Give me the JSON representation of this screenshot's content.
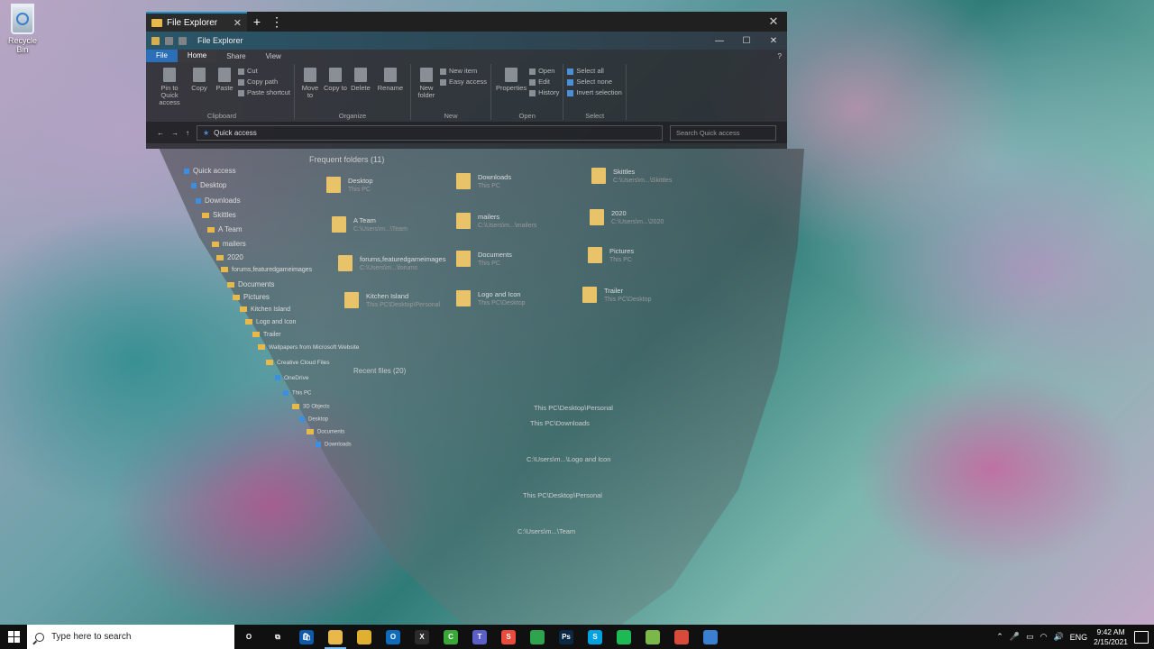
{
  "desktop": {
    "recycle_bin": "Recycle Bin"
  },
  "browser": {
    "tab_title": "File Explorer",
    "new_tab": "+",
    "menu": "⋮",
    "close": "✕"
  },
  "explorer": {
    "title": "File Explorer",
    "window_controls": {
      "min": "—",
      "max": "☐",
      "close": "✕"
    },
    "ribbon_tabs": [
      "File",
      "Home",
      "Share",
      "View"
    ],
    "help": "?",
    "clipboard": {
      "pin": "Pin to Quick access",
      "copy": "Copy",
      "paste": "Paste",
      "cut": "Cut",
      "copy_path": "Copy path",
      "paste_shortcut": "Paste shortcut",
      "caption": "Clipboard"
    },
    "organize": {
      "move_to": "Move to",
      "copy_to": "Copy to",
      "delete": "Delete",
      "rename": "Rename",
      "caption": "Organize"
    },
    "new": {
      "new_folder": "New folder",
      "new_item": "New item",
      "easy_access": "Easy access",
      "caption": "New"
    },
    "open": {
      "properties": "Properties",
      "open": "Open",
      "edit": "Edit",
      "history": "History",
      "caption": "Open"
    },
    "select": {
      "select_all": "Select all",
      "select_none": "Select none",
      "invert": "Invert selection",
      "caption": "Select"
    },
    "address": {
      "path": "Quick access",
      "search_placeholder": "Search Quick access"
    },
    "nav": [
      "Quick access",
      "Desktop",
      "Downloads",
      "Skittles",
      "A Team",
      "mailers",
      "2020",
      "forums,featuredgameimages",
      "Documents",
      "Pictures",
      "Kitchen Island",
      "Logo and Icon",
      "Trailer",
      "Wallpapers from Microsoft Website",
      "Creative Cloud Files",
      "OneDrive",
      "This PC",
      "3D Objects",
      "Desktop",
      "Documents",
      "Downloads"
    ],
    "frequent_header": "Frequent folders (11)",
    "frequent": [
      {
        "name": "Desktop",
        "loc": "This PC"
      },
      {
        "name": "Downloads",
        "loc": "This PC"
      },
      {
        "name": "Skittles",
        "loc": "C:\\Users\\m...\\Skittles"
      },
      {
        "name": "A Team",
        "loc": "C:\\Users\\m...\\Team"
      },
      {
        "name": "mailers",
        "loc": "C:\\Users\\m...\\mailers"
      },
      {
        "name": "2020",
        "loc": "C:\\Users\\m...\\2020"
      },
      {
        "name": "forums,featuredgameimages",
        "loc": "C:\\Users\\m...\\forums"
      },
      {
        "name": "Documents",
        "loc": "This PC"
      },
      {
        "name": "Pictures",
        "loc": "This PC"
      },
      {
        "name": "Kitchen Island",
        "loc": "This PC\\Desktop\\Personal"
      },
      {
        "name": "Logo and Icon",
        "loc": "This PC\\Desktop"
      },
      {
        "name": "Trailer",
        "loc": "This PC\\Desktop"
      }
    ],
    "recent_header": "Recent files (20)",
    "recent_paths": [
      "This PC\\Desktop\\Personal",
      "This PC\\Downloads",
      "C:\\Users\\m...\\Logo and Icon",
      "This PC\\Desktop\\Personal",
      "C:\\Users\\m...\\Team"
    ]
  },
  "taskbar": {
    "search_placeholder": "Type here to search",
    "apps": [
      {
        "name": "task-view",
        "label": "O",
        "color": "#101010"
      },
      {
        "name": "multitask",
        "label": "⧉",
        "color": "#101010"
      },
      {
        "name": "store",
        "label": "🛍",
        "color": "#0f5aa8"
      },
      {
        "name": "file-explorer",
        "label": "",
        "color": "#e8b84a"
      },
      {
        "name": "chrome-canary",
        "label": "",
        "color": "#e0b030"
      },
      {
        "name": "outlook",
        "label": "O",
        "color": "#0f6cbd"
      },
      {
        "name": "xbox",
        "label": "X",
        "color": "#2b2b2b"
      },
      {
        "name": "camtasia",
        "label": "C",
        "color": "#3aa836"
      },
      {
        "name": "teams",
        "label": "T",
        "color": "#5b5fc7"
      },
      {
        "name": "snagit",
        "label": "S",
        "color": "#e94b3c"
      },
      {
        "name": "chrome",
        "label": "",
        "color": "#2ea44f"
      },
      {
        "name": "photoshop",
        "label": "Ps",
        "color": "#0b2844"
      },
      {
        "name": "skype",
        "label": "S",
        "color": "#00a3e0"
      },
      {
        "name": "spotify",
        "label": "",
        "color": "#1db954"
      },
      {
        "name": "notepad",
        "label": "",
        "color": "#7ab84a"
      },
      {
        "name": "package",
        "label": "",
        "color": "#d84a3a"
      },
      {
        "name": "gem",
        "label": "",
        "color": "#3a7fd0"
      }
    ],
    "tray": {
      "lang": "ENG",
      "time": "9:42 AM",
      "date": "2/15/2021"
    }
  }
}
